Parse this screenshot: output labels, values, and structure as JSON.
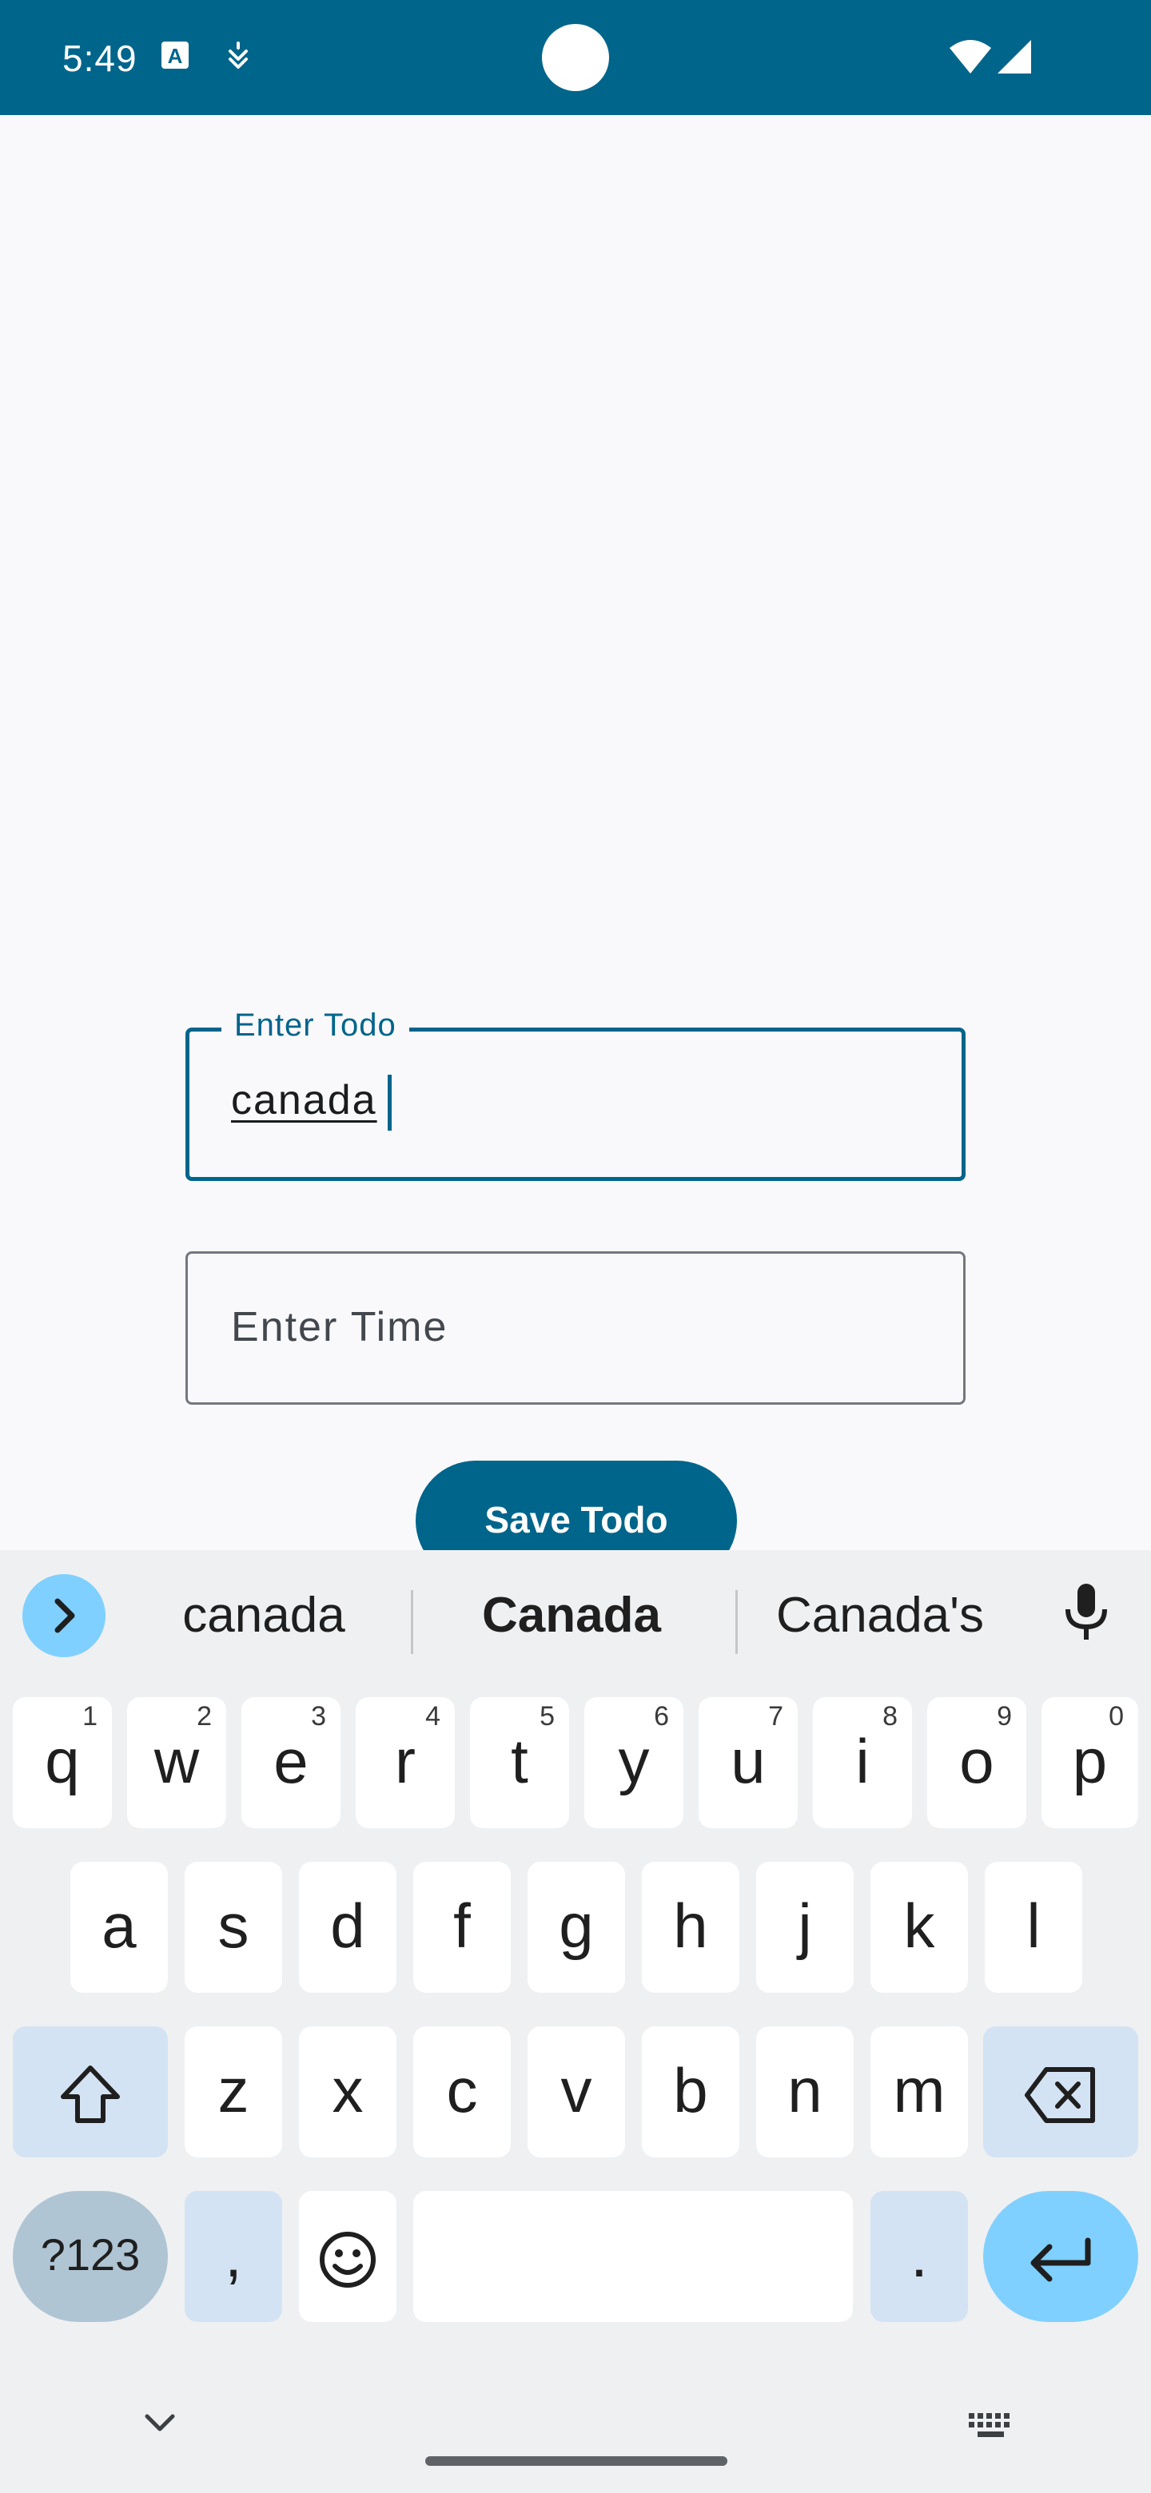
{
  "status_bar": {
    "time": "5:49",
    "left_icons": [
      "a-badge-icon",
      "notification-icon"
    ],
    "right_icons": [
      "wifi-icon",
      "signal-icon"
    ]
  },
  "form": {
    "todo_label": "Enter Todo",
    "todo_value": "canada",
    "time_placeholder": "Enter Time",
    "save_label": "Save Todo"
  },
  "keyboard": {
    "suggestions": [
      "canada",
      "Canada",
      "Canada's"
    ],
    "row1": [
      {
        "key": "q",
        "hint": "1"
      },
      {
        "key": "w",
        "hint": "2"
      },
      {
        "key": "e",
        "hint": "3"
      },
      {
        "key": "r",
        "hint": "4"
      },
      {
        "key": "t",
        "hint": "5"
      },
      {
        "key": "y",
        "hint": "6"
      },
      {
        "key": "u",
        "hint": "7"
      },
      {
        "key": "i",
        "hint": "8"
      },
      {
        "key": "o",
        "hint": "9"
      },
      {
        "key": "p",
        "hint": "0"
      }
    ],
    "row2": [
      "a",
      "s",
      "d",
      "f",
      "g",
      "h",
      "j",
      "k",
      "l"
    ],
    "row3": [
      "z",
      "x",
      "c",
      "v",
      "b",
      "n",
      "m"
    ],
    "symbols_label": "?123",
    "comma": ",",
    "period": "."
  },
  "colors": {
    "primary": "#00658b",
    "background": "#f9f9fc",
    "keyboard_bg": "#eff0f2",
    "accent_key": "#7fd0ff"
  }
}
